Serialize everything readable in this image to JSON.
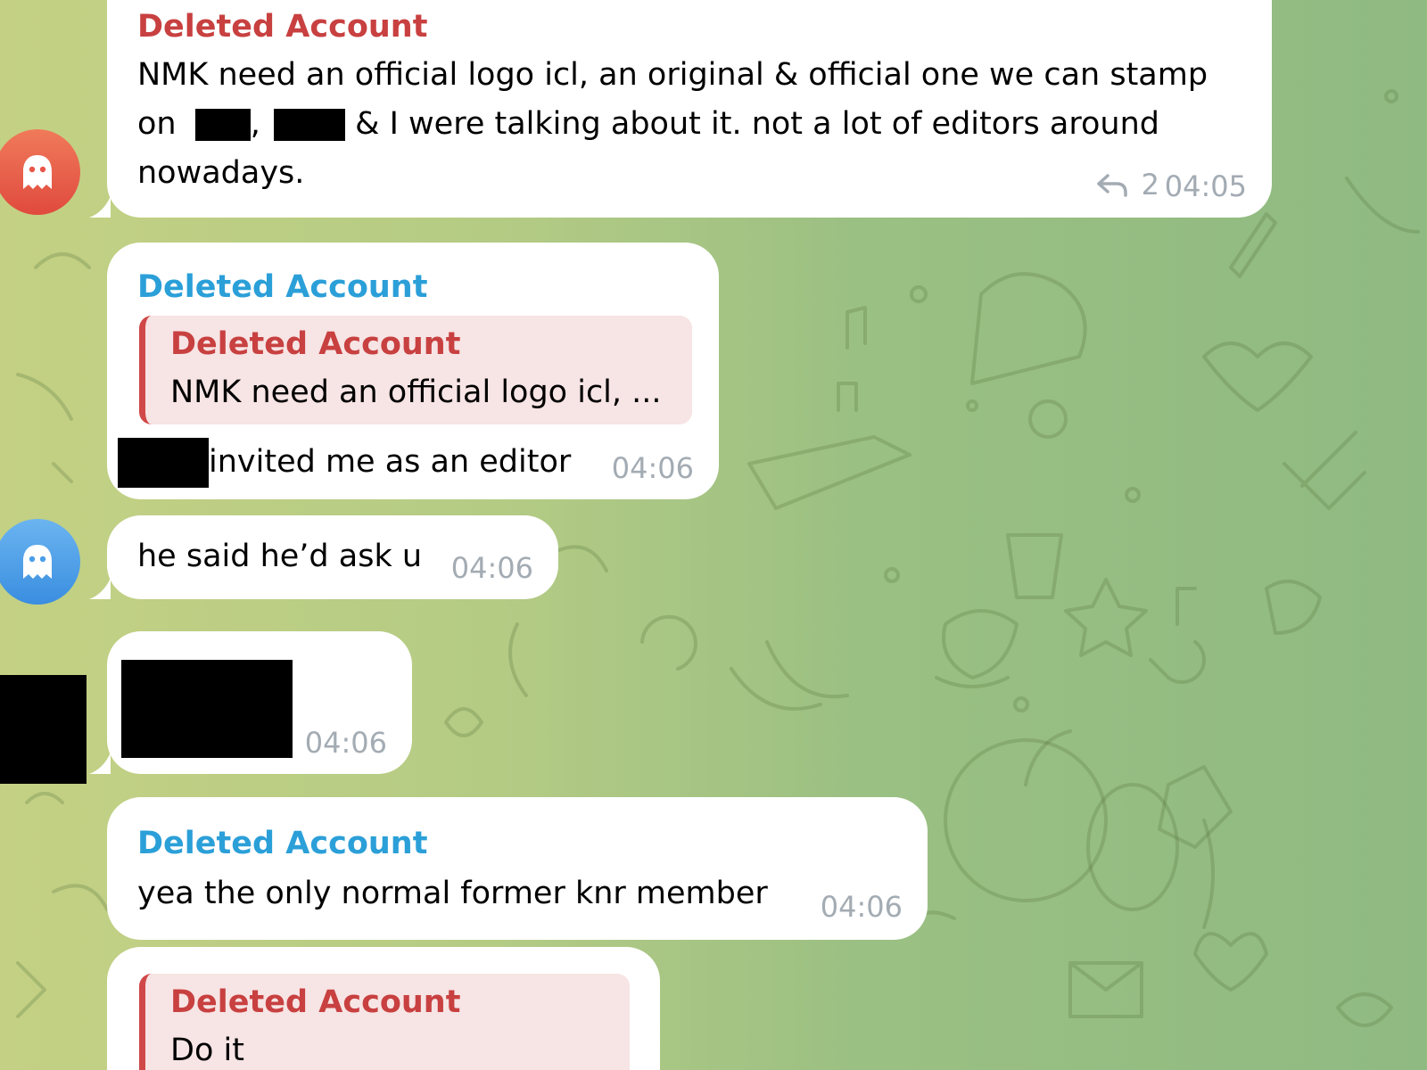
{
  "colors": {
    "sender_red": "#c84040",
    "sender_blue": "#2b9fd8",
    "quote_bg": "#f7e4e4",
    "quote_bar": "#d04848",
    "avatar_red": "#e8564a",
    "avatar_blue": "#4a9ee8"
  },
  "messages": [
    {
      "sender": "Deleted Account",
      "line1": "NMK need an official logo icl, an original & official one we can stamp",
      "line2_prefix": "on",
      "line2_comma": ",",
      "line2_suffix": "& I were talking about it. not a lot of editors around",
      "line3": "nowadays.",
      "replies_icon": "reply-arrow-icon",
      "replies_count": "2",
      "time": "04:05"
    },
    {
      "sender": "Deleted Account",
      "quote_sender": "Deleted Account",
      "quote_text": "NMK need an official logo icl, ...",
      "text": "invited me as an editor",
      "time": "04:06"
    },
    {
      "text": "he said he’d ask u",
      "time": "04:06"
    },
    {
      "time": "04:06"
    },
    {
      "sender": "Deleted Account",
      "text": "yea the only normal former knr member",
      "time": "04:06"
    },
    {
      "quote_sender": "Deleted Account",
      "quote_text": "Do it"
    }
  ],
  "avatars": {
    "ghost_icon": "ghost-icon"
  }
}
